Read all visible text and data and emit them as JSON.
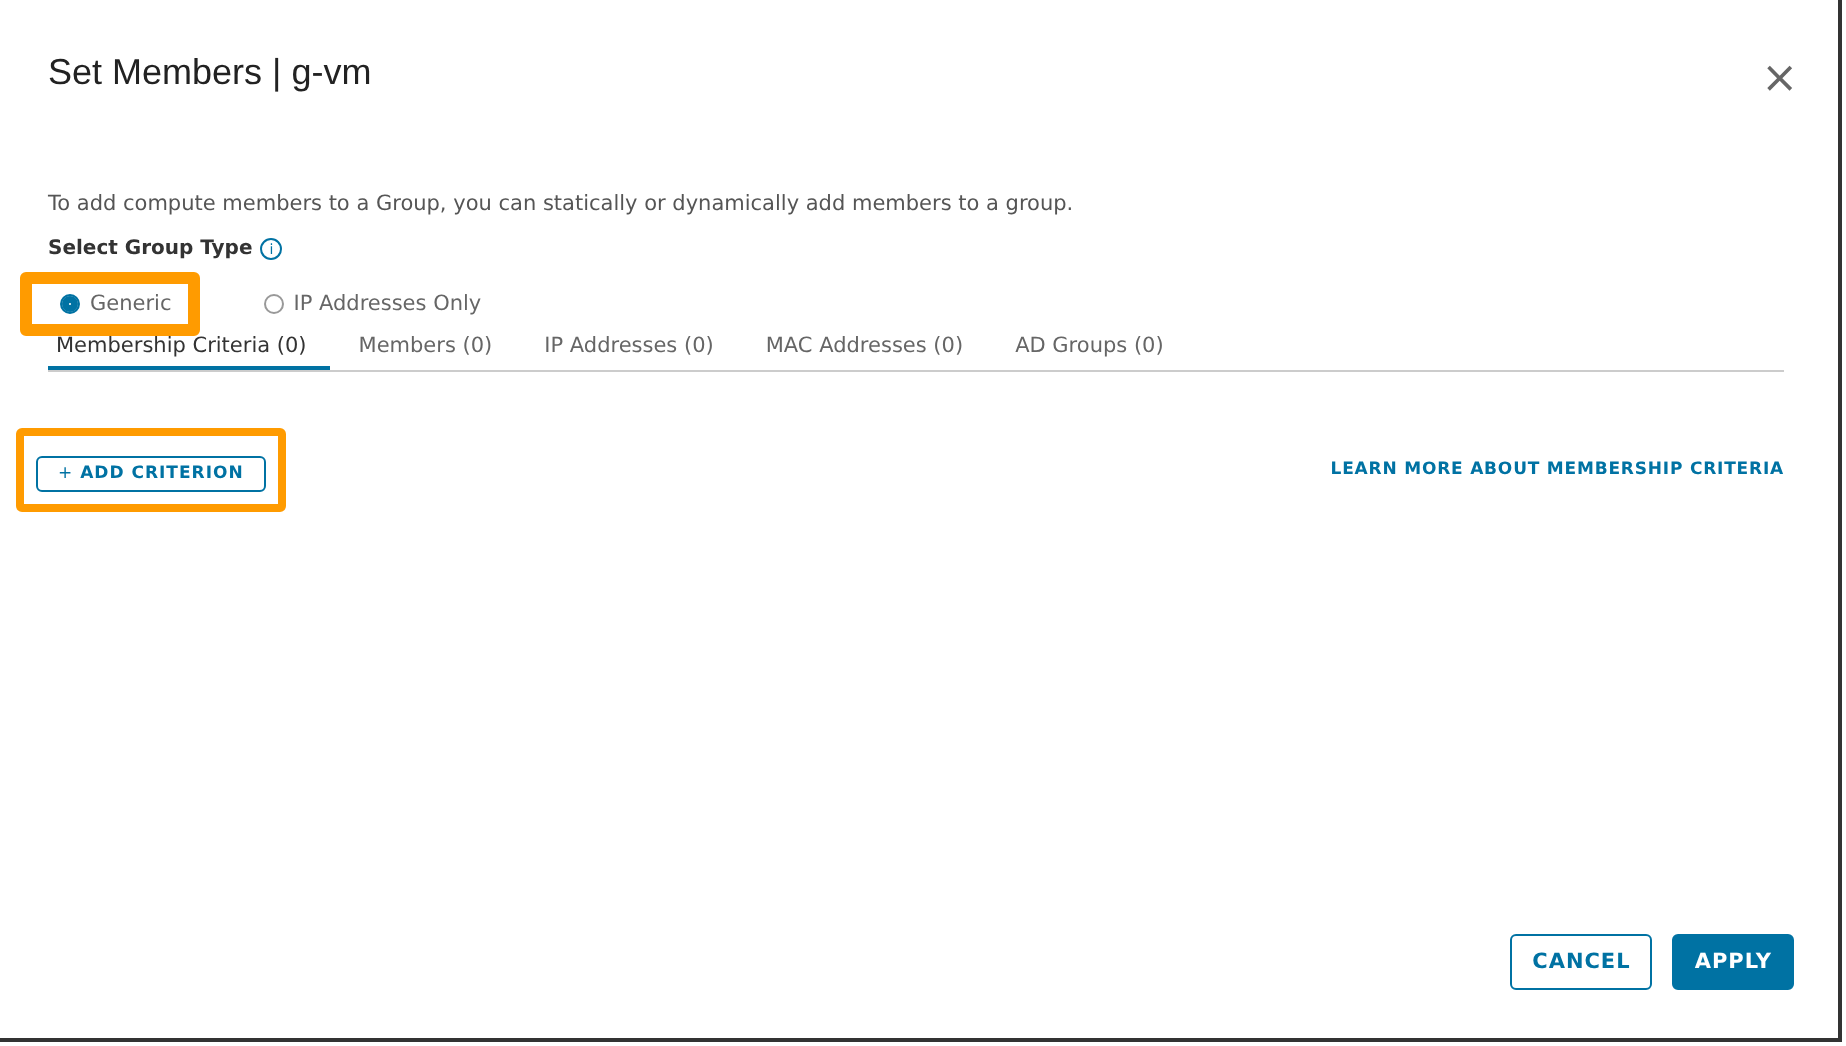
{
  "dialog": {
    "title": "Set Members | g-vm",
    "close": "×"
  },
  "description": "To add compute members to a Group, you can statically or dynamically add members to a group.",
  "group_type": {
    "label": "Select Group Type",
    "info": "i",
    "options": [
      {
        "label": "Generic",
        "selected": true,
        "highlighted": true
      },
      {
        "label": "IP Addresses Only",
        "selected": false,
        "highlighted": false
      }
    ]
  },
  "tabs": [
    {
      "label": "Membership Criteria (0)",
      "selected": true
    },
    {
      "label": "Members (0)",
      "selected": false
    },
    {
      "label": "IP Addresses (0)",
      "selected": false
    },
    {
      "label": "MAC Addresses (0)",
      "selected": false
    },
    {
      "label": "AD Groups (0)",
      "selected": false
    }
  ],
  "add_button": {
    "icon": "+",
    "label": "ADD CRITERION",
    "highlighted": true
  },
  "learn_more": "LEARN MORE ABOUT MEMBERSHIP CRITERIA",
  "buttons": [
    {
      "label": "CANCEL",
      "kind": "secondary"
    },
    {
      "label": "APPLY",
      "kind": "primary"
    }
  ]
}
